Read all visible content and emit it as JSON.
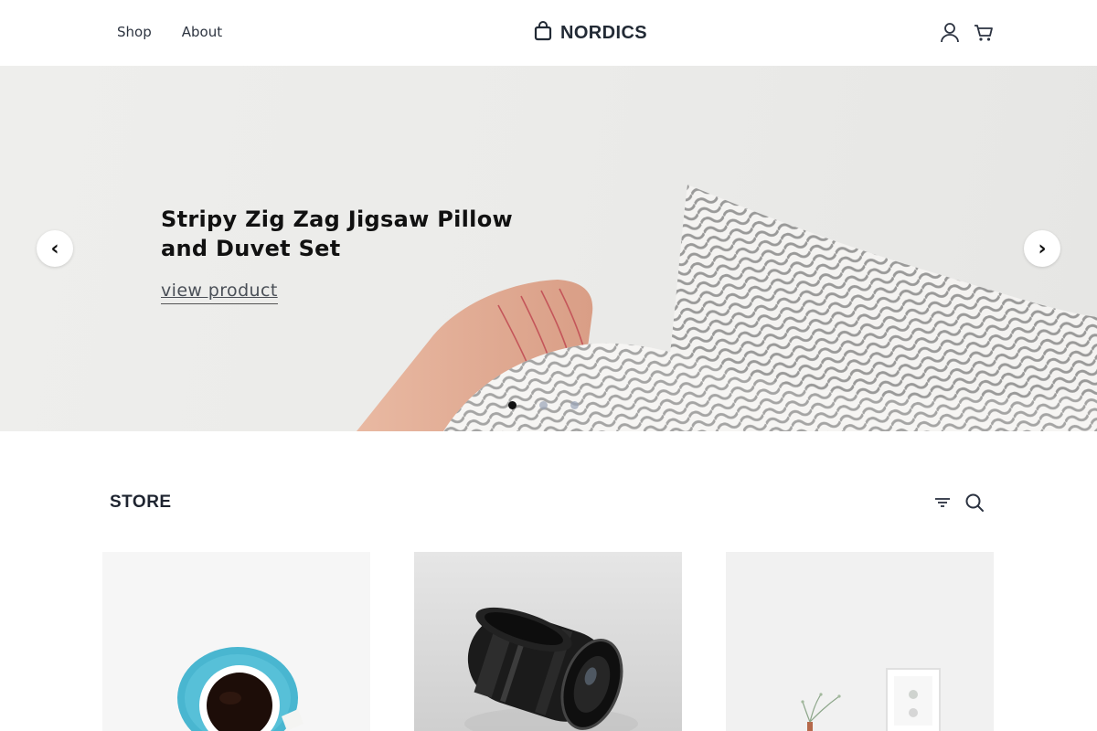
{
  "header": {
    "nav": [
      {
        "label": "Shop"
      },
      {
        "label": "About"
      }
    ],
    "logo_text": "NORDICS",
    "icons": [
      "bag-icon",
      "user-icon",
      "cart-icon"
    ]
  },
  "hero": {
    "title": "Stripy Zig Zag Jigsaw Pillow and Duvet Set",
    "link_label": "view product",
    "prev_label": "‹",
    "next_label": "›",
    "slide_count": 3,
    "active_slide": 1
  },
  "store": {
    "title": "STORE",
    "tool_icons": [
      "filter-icon",
      "search-icon"
    ],
    "products": [
      {
        "image": "blue-coffee-cup"
      },
      {
        "image": "camera-lens"
      },
      {
        "image": "plant-and-frame"
      }
    ]
  },
  "colors": {
    "text": "#1f2530",
    "hero_bg": "#ecebe9",
    "accent_blue": "#49b6d0"
  }
}
